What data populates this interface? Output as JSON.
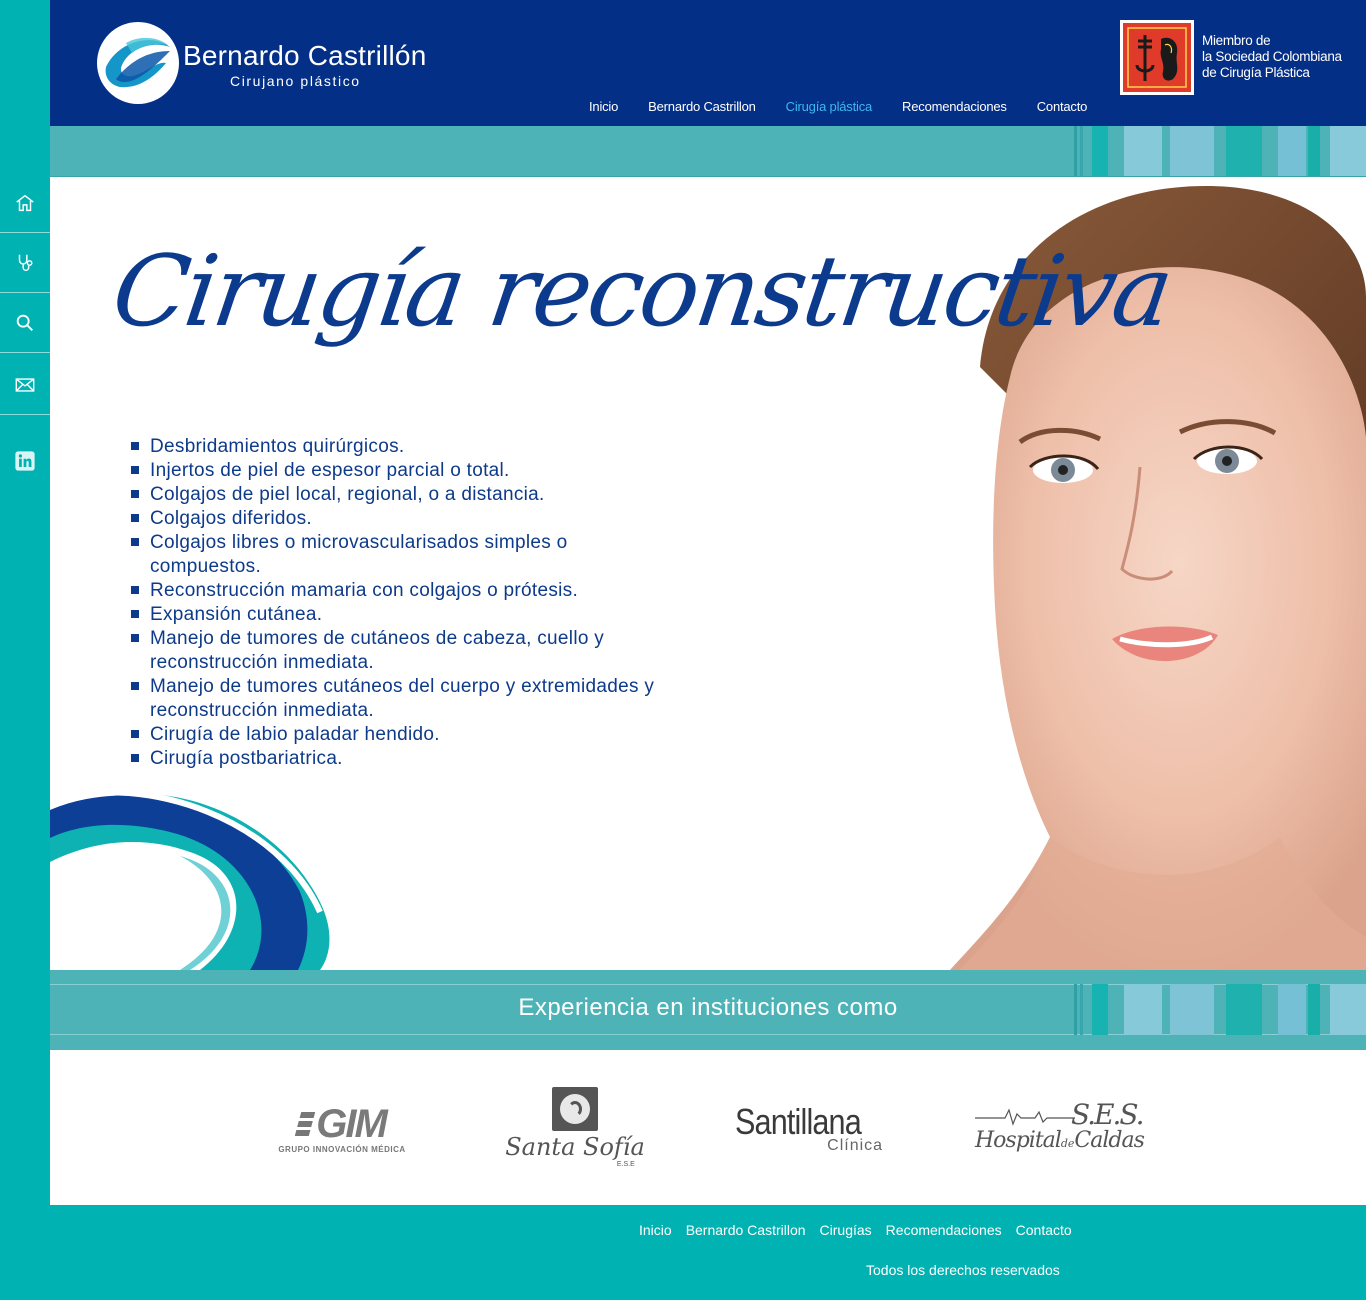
{
  "brand": {
    "name": "Bernardo Castrillón",
    "subtitle": "Cirujano plástico"
  },
  "membership": {
    "line1": "Miembro de",
    "line2": "la Sociedad Colombiana",
    "line3": "de Cirugía Plástica"
  },
  "nav": {
    "items": [
      "Inicio",
      "Bernardo Castrillon",
      "Cirugía plástica",
      "Recomendaciones",
      "Contacto"
    ],
    "active": "Cirugía plástica"
  },
  "sidebar": {
    "icons": [
      "home-icon",
      "stethoscope-icon",
      "search-icon",
      "mail-icon",
      "linkedin-icon"
    ]
  },
  "hero": {
    "title": "Cirugía reconstructiva",
    "services": [
      "Desbridamientos quirúrgicos.",
      "Injertos de piel de espesor parcial o total.",
      "Colgajos de piel local, regional, o a distancia.",
      "Colgajos diferidos.",
      "Colgajos libres o microvascularisados simples o compuestos.",
      "Reconstrucción mamaria con colgajos o prótesis.",
      "Expansión cutánea.",
      "Manejo de tumores de cutáneos de cabeza, cuello y reconstrucción inmediata.",
      "Manejo de tumores cutáneos del  cuerpo y extremidades y reconstrucción inmediata.",
      "Cirugía de labio paladar hendido.",
      "Cirugía postbariatrica."
    ]
  },
  "experience": {
    "title": "Experiencia en instituciones como",
    "logos": {
      "gim": {
        "mark": "GIM",
        "caption": "GRUPO INNOVACIÓN MÉDICA"
      },
      "santa_sofia": {
        "name": "Santa Sofía",
        "caption": "E.S.E"
      },
      "santillana": {
        "name": "Santillana",
        "caption": "Clínica"
      },
      "ses": {
        "mark": "S.E.S.",
        "name": "Hospital",
        "small": "de",
        "place": "Caldas"
      }
    }
  },
  "footer": {
    "nav": [
      "Inicio",
      "Bernardo Castrillon",
      "Cirugías",
      "Recomendaciones",
      "Contacto"
    ],
    "rights": "Todos los derechos reservados"
  },
  "colors": {
    "header": "#042f86",
    "teal": "#00b2b2",
    "band": "#4eb3b6",
    "title": "#0c3a8c",
    "active_link": "#3db8ee"
  }
}
